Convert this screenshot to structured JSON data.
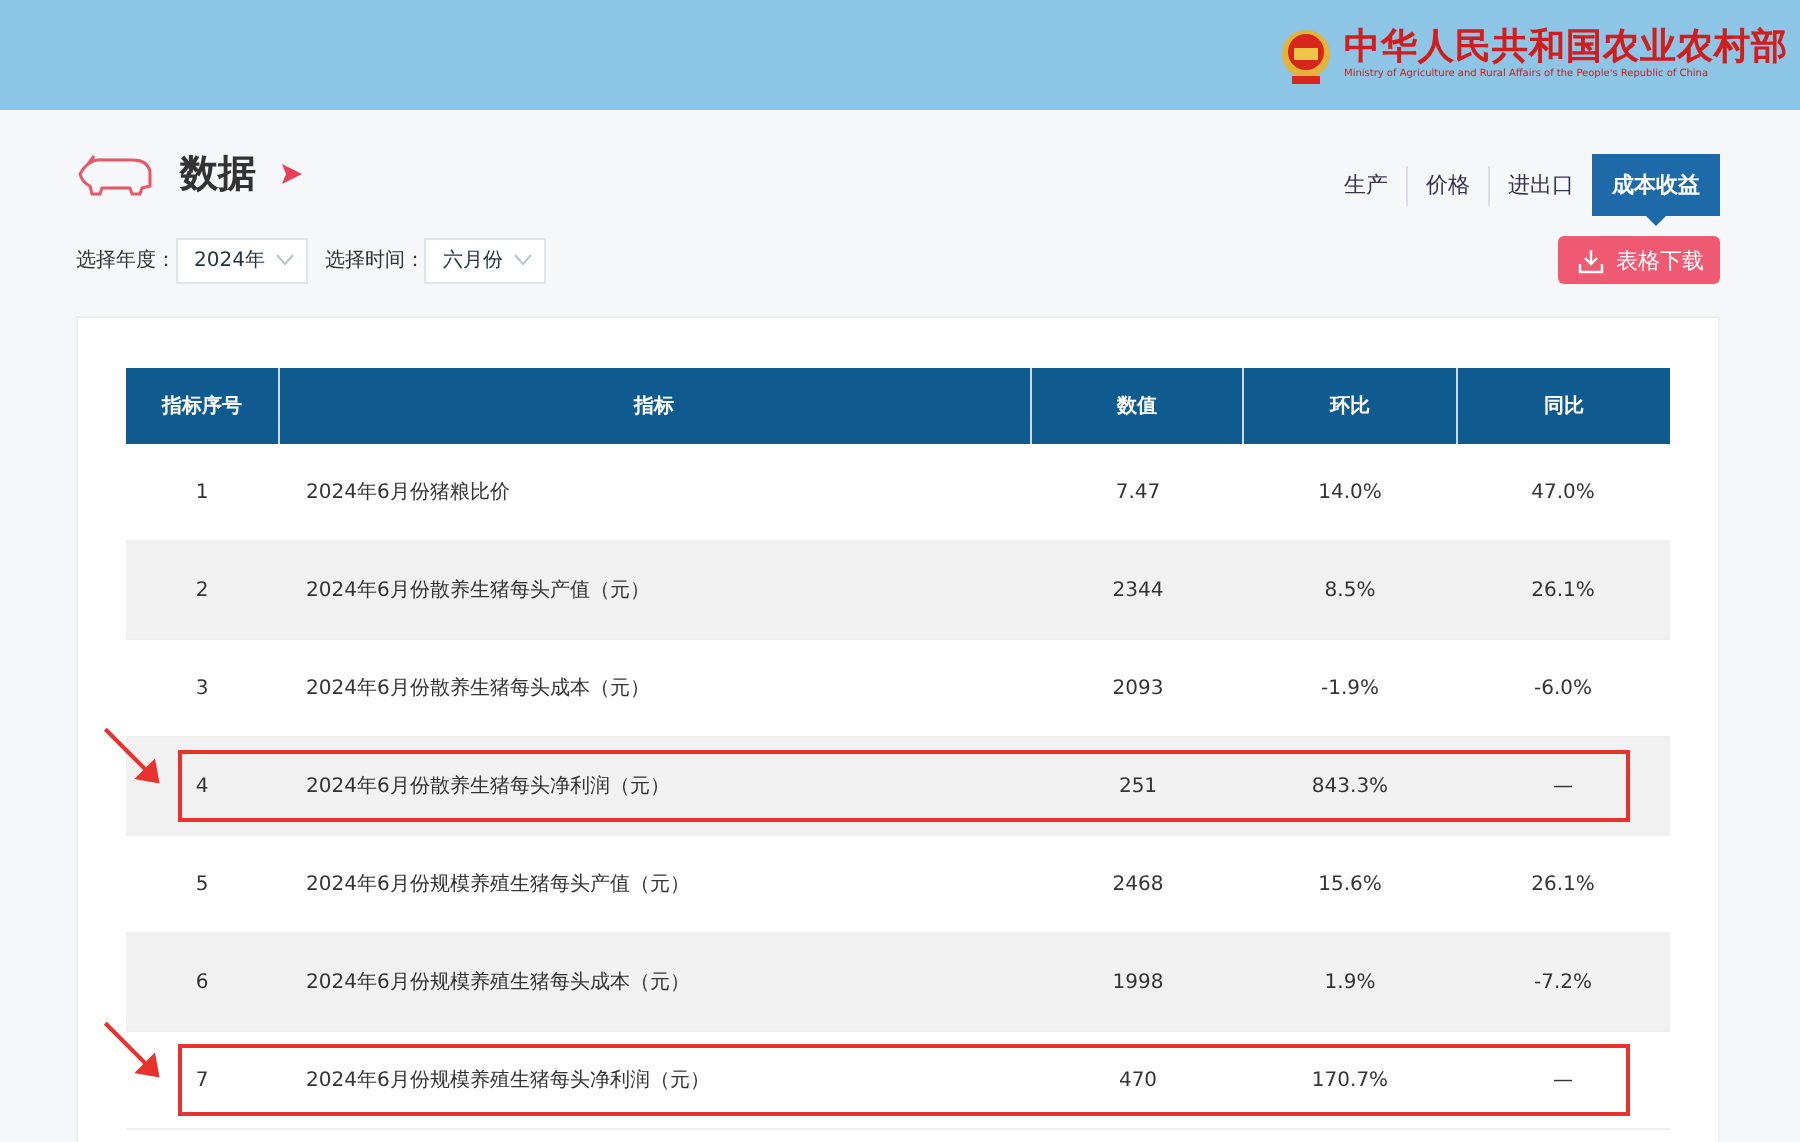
{
  "header": {
    "title": "中华人民共和国农业农村部",
    "subtitle": "Ministry of Agriculture and Rural Affairs of the People's Republic of China"
  },
  "section": {
    "title": "数据"
  },
  "tabs": [
    {
      "label": "生产",
      "selected": false
    },
    {
      "label": "价格",
      "selected": false
    },
    {
      "label": "进出口",
      "selected": false
    },
    {
      "label": "成本收益",
      "selected": true
    }
  ],
  "filters": [
    {
      "label": "选择年度：",
      "value": "2024年"
    },
    {
      "label": "选择时间：",
      "value": "六月份"
    }
  ],
  "download_button": "表格下载",
  "table": {
    "columns": [
      "指标序号",
      "指标",
      "数值",
      "环比",
      "同比"
    ],
    "rows": [
      {
        "cells": [
          "1",
          "2024年6月份猪粮比价",
          "7.47",
          "14.0%",
          "47.0%"
        ],
        "highlighted": false
      },
      {
        "cells": [
          "2",
          "2024年6月份散养生猪每头产值（元）",
          "2344",
          "8.5%",
          "26.1%"
        ],
        "highlighted": false
      },
      {
        "cells": [
          "3",
          "2024年6月份散养生猪每头成本（元）",
          "2093",
          "-1.9%",
          "-6.0%"
        ],
        "highlighted": false
      },
      {
        "cells": [
          "4",
          "2024年6月份散养生猪每头净利润（元）",
          "251",
          "843.3%",
          "—"
        ],
        "highlighted": true
      },
      {
        "cells": [
          "5",
          "2024年6月份规模养殖生猪每头产值（元）",
          "2468",
          "15.6%",
          "26.1%"
        ],
        "highlighted": false
      },
      {
        "cells": [
          "6",
          "2024年6月份规模养殖生猪每头成本（元）",
          "1998",
          "1.9%",
          "-7.2%"
        ],
        "highlighted": false
      },
      {
        "cells": [
          "7",
          "2024年6月份规模养殖生猪每头净利润（元）",
          "470",
          "170.7%",
          "—"
        ],
        "highlighted": true
      }
    ]
  }
}
